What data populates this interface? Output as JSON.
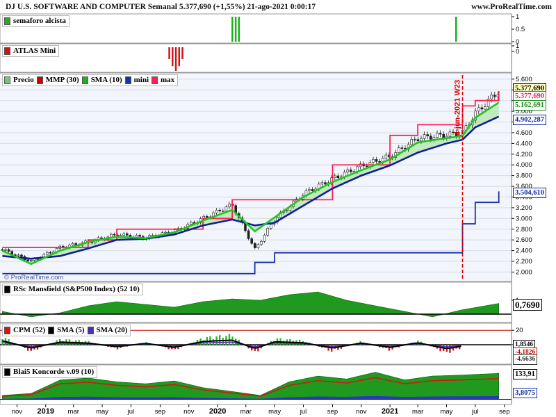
{
  "header": {
    "title": "DJ U.S. SOFTWARE AND COMPUTER Semanal 5.377,690 (+1,55%) 21-ago-2021 0:00:17",
    "site": "www.ProRealTime.com",
    "watermark": "© ProRealTime.com"
  },
  "panels": {
    "semaforo": {
      "label": "semaforo alcista",
      "ticks": [
        "1",
        "0.5",
        "0"
      ]
    },
    "atlas": {
      "label": "ATLAS Mini",
      "ticks": [
        "1",
        "0"
      ]
    },
    "price": {
      "legend": [
        "Precio",
        "MMP (30)",
        "SMA (10)",
        "mini",
        "max"
      ],
      "annotation": "4-jun-2021 W23",
      "tags": {
        "last": "5.377,690",
        "max": "5.377,690",
        "sma10": "5.162,691",
        "mmp30": "4.902,287",
        "mini": "3.504,610"
      }
    },
    "rsc": {
      "label": "RSc Mansfield (S&P500 Index) (52 10)",
      "tag": "0,7690",
      "ticks": [
        "1"
      ]
    },
    "cpm": {
      "legend": [
        "CPM (52)",
        "SMA (5)",
        "SMA (20)"
      ],
      "tags": [
        "1,8546",
        "-4,1826",
        "-4,6636"
      ],
      "ticks": [
        "20",
        "0"
      ]
    },
    "blai5": {
      "label": "Blai5 Koncorde v.09 (10)",
      "tags": [
        "133,91",
        "3,8075"
      ]
    }
  },
  "x_axis": {
    "labels": [
      "nov",
      "2019",
      "mar",
      "may",
      "jul",
      "sep",
      "nov",
      "2020",
      "mar",
      "may",
      "jul",
      "sep",
      "nov",
      "2021",
      "mar",
      "may",
      "jul",
      "sep"
    ]
  },
  "chart_data": [
    {
      "type": "line",
      "title": "DJ U.S. SOFTWARE AND COMPUTER Semanal",
      "x": [
        "2018-10-01",
        "2018-12-01",
        "2019-02-01",
        "2019-04-01",
        "2019-06-01",
        "2019-08-01",
        "2019-10-01",
        "2019-12-01",
        "2020-02-01",
        "2020-03-20",
        "2020-05-01",
        "2020-07-01",
        "2020-09-01",
        "2020-11-01",
        "2021-01-01",
        "2021-03-01",
        "2021-05-01",
        "2021-06-04",
        "2021-07-01",
        "2021-08-20"
      ],
      "series": [
        {
          "name": "Precio",
          "values": [
            2420,
            2200,
            2460,
            2560,
            2700,
            2640,
            2760,
            3000,
            3260,
            2420,
            2980,
            3460,
            3740,
            3980,
            4160,
            4500,
            4560,
            4600,
            4960,
            5377.69
          ]
        },
        {
          "name": "MMP (30)",
          "values": [
            2300,
            2250,
            2300,
            2440,
            2600,
            2620,
            2700,
            2870,
            2980,
            2870,
            2920,
            3240,
            3560,
            3800,
            3990,
            4230,
            4400,
            4470,
            4700,
            4902.287
          ]
        },
        {
          "name": "SMA (10)",
          "values": [
            2400,
            2150,
            2400,
            2560,
            2660,
            2630,
            2740,
            2960,
            3160,
            2760,
            3020,
            3400,
            3680,
            3900,
            4100,
            4420,
            4500,
            4540,
            4880,
            5162.691
          ]
        },
        {
          "name": "mini",
          "values": [
            1970,
            1970,
            1970,
            1970,
            1970,
            1970,
            1970,
            1970,
            1970,
            2180,
            2360,
            2360,
            2360,
            2360,
            2360,
            2360,
            2360,
            2900,
            3300,
            3504.61
          ]
        },
        {
          "name": "max",
          "values": [
            2460,
            2460,
            2460,
            2600,
            2800,
            2800,
            2800,
            3000,
            3350,
            3350,
            3350,
            3350,
            4000,
            4000,
            4550,
            4750,
            4750,
            5100,
            5200,
            5377.69
          ]
        }
      ],
      "ylim": [
        1850,
        5650
      ],
      "yticks": [
        2000,
        2200,
        2400,
        2600,
        2800,
        3000,
        3200,
        3400,
        3600,
        3800,
        4000,
        4200,
        4400,
        4600,
        4800,
        5000,
        5200,
        5400,
        5600
      ],
      "ytick_labels": [
        "2.000",
        "2.200",
        "2.400",
        "2.600",
        "2.800",
        "3.000",
        "3.200",
        "3.400",
        "3.600",
        "3.800",
        "4.000",
        "4.200",
        "4.400",
        "4.600",
        "4.800",
        "5.000",
        "5.200",
        "5.400",
        "5.600"
      ],
      "grid": true,
      "annotation": {
        "date": "2021-06-04",
        "text": "4-jun-2021 W23"
      }
    },
    {
      "type": "bar",
      "title": "semaforo alcista",
      "x": [
        "2020-02-01",
        "2020-02-08",
        "2020-02-15",
        "2021-05-21"
      ],
      "values": [
        1,
        1,
        1,
        1
      ],
      "ylim": [
        0,
        1
      ]
    },
    {
      "type": "bar",
      "title": "ATLAS Mini",
      "x": [
        "2019-09-20",
        "2019-09-27",
        "2019-10-04",
        "2019-10-11",
        "2019-10-18"
      ],
      "values": [
        -0.5,
        -0.8,
        -1,
        -0.8,
        -0.5
      ],
      "ylim": [
        -1,
        0
      ]
    },
    {
      "type": "area",
      "title": "RSc Mansfield (S&P500 Index) (52 10)",
      "x": [
        "2018-10-01",
        "2018-12-01",
        "2019-02-01",
        "2019-04-01",
        "2019-06-01",
        "2019-08-01",
        "2019-10-01",
        "2019-12-01",
        "2020-02-01",
        "2020-04-01",
        "2020-06-01",
        "2020-08-01",
        "2020-10-01",
        "2020-12-01",
        "2021-02-01",
        "2021-04-01",
        "2021-06-01",
        "2021-08-20"
      ],
      "values": [
        0.2,
        -0.2,
        0.1,
        0.6,
        0.9,
        0.7,
        0.5,
        0.9,
        1.1,
        1.0,
        1.4,
        1.6,
        1.0,
        0.6,
        0.2,
        -0.2,
        0.3,
        0.769
      ],
      "ylim": [
        -0.5,
        2.0
      ]
    },
    {
      "type": "bar",
      "title": "CPM (52)",
      "x": [
        "2018-10-01",
        "2018-12-01",
        "2019-02-01",
        "2019-04-01",
        "2019-06-01",
        "2019-08-01",
        "2019-10-01",
        "2019-12-01",
        "2020-02-01",
        "2020-04-01",
        "2020-06-01",
        "2020-08-01",
        "2020-10-01",
        "2020-12-01",
        "2021-02-01",
        "2021-04-01",
        "2021-06-01",
        "2021-08-20"
      ],
      "values": [
        12,
        -10,
        8,
        5,
        -6,
        4,
        -8,
        10,
        14,
        -12,
        9,
        6,
        -10,
        5,
        -8,
        6,
        -12,
        -4.1826
      ],
      "ylim": [
        -25,
        25
      ]
    },
    {
      "type": "area",
      "title": "Blai5 Koncorde v.09 (10)",
      "x": [
        "2018-10-01",
        "2018-12-01",
        "2019-02-01",
        "2019-04-01",
        "2019-06-01",
        "2019-08-01",
        "2019-10-01",
        "2019-12-01",
        "2020-02-01",
        "2020-04-01",
        "2020-06-01",
        "2020-08-01",
        "2020-10-01",
        "2020-12-01",
        "2021-02-01",
        "2021-04-01",
        "2021-06-01",
        "2021-08-20"
      ],
      "values": [
        20,
        30,
        100,
        110,
        90,
        80,
        95,
        60,
        40,
        20,
        90,
        120,
        105,
        140,
        100,
        120,
        125,
        133.91
      ],
      "ylim": [
        -20,
        160
      ]
    }
  ]
}
